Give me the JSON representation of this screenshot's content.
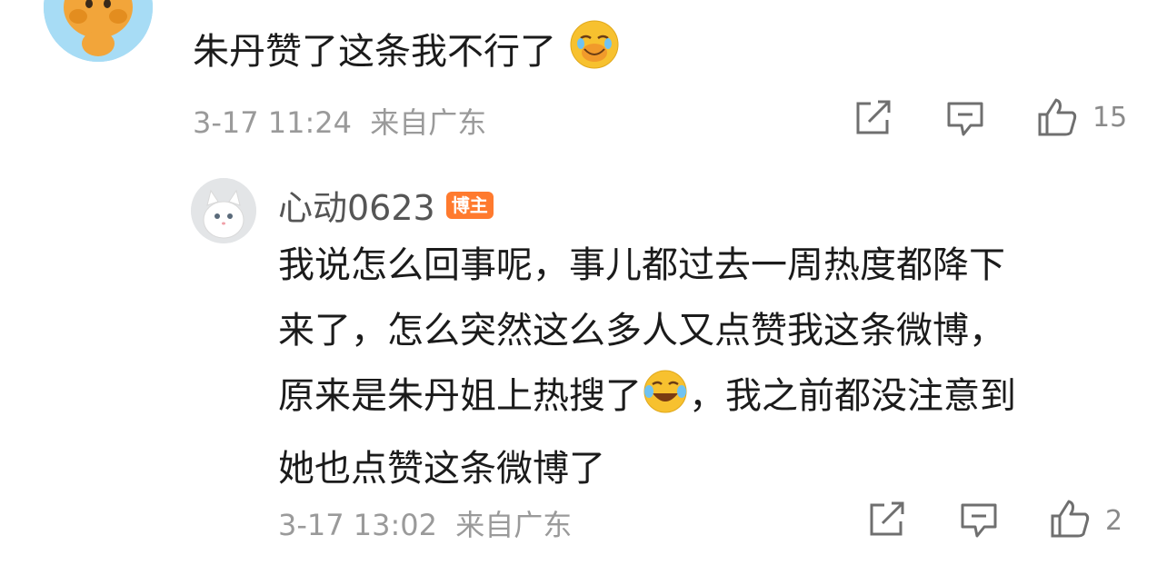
{
  "comment": {
    "text": "朱丹赞了这条我不行了",
    "emoji_icon": "crying-laughing-emoji",
    "time": "3-17 11:24",
    "location": "来自广东",
    "likes": "15"
  },
  "reply": {
    "username": "心动0623",
    "badge": "博主",
    "lines": [
      "我说怎么回事呢，事儿都过去一周热度都降下",
      "来了，怎么突然这么多人又点赞我这条微博，",
      "原来是朱丹姐上热搜了",
      "，我之前都没注意到",
      "她也点赞这条微博了"
    ],
    "emoji_icon": "laughing-tears-emoji",
    "time": "3-17 13:02",
    "location": "来自广东",
    "likes": "2"
  },
  "icons": {
    "share": "share-icon",
    "comment": "comment-icon",
    "like": "thumbs-up-icon"
  },
  "colors": {
    "badge": "#ff7a2e",
    "meta": "#9a9a9a",
    "emoji": "#f7c12f"
  }
}
